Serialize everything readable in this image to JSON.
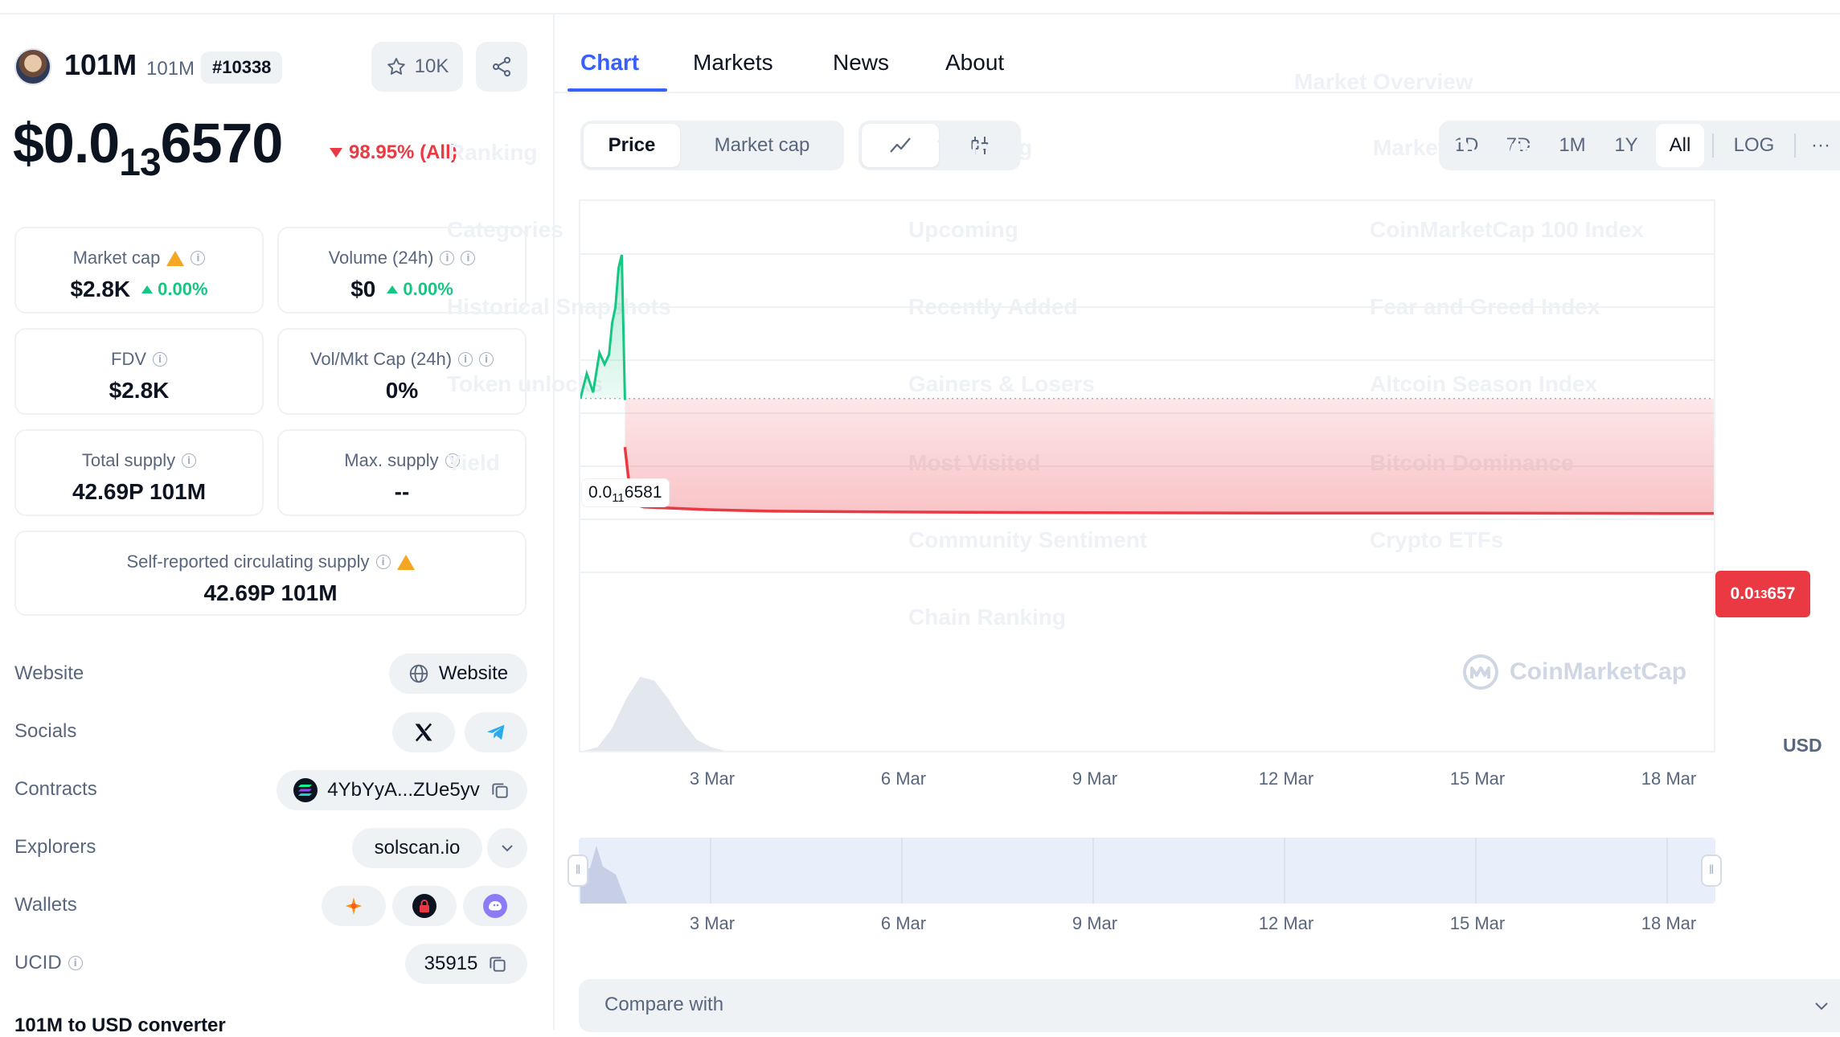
{
  "coin": {
    "name": "101M",
    "symbol": "101M",
    "rank": "#10338",
    "watchlist_count": "10K",
    "price_main": "$0.0",
    "price_sub": "13",
    "price_tail": "6570",
    "change": "98.95% (All)"
  },
  "stats": {
    "market_cap_label": "Market cap",
    "market_cap_value": "$2.8K",
    "market_cap_change": "0.00%",
    "volume_label": "Volume (24h)",
    "volume_value": "$0",
    "volume_change": "0.00%",
    "fdv_label": "FDV",
    "fdv_value": "$2.8K",
    "volmkt_label": "Vol/Mkt Cap (24h)",
    "volmkt_value": "0%",
    "total_supply_label": "Total supply",
    "total_supply_value": "42.69P 101M",
    "max_supply_label": "Max. supply",
    "max_supply_value": "--",
    "circ_label": "Self-reported circulating supply",
    "circ_value": "42.69P 101M"
  },
  "info_rows": {
    "website_label": "Website",
    "website_button": "Website",
    "socials_label": "Socials",
    "contracts_label": "Contracts",
    "contract_address": "4YbYyA...ZUe5yv",
    "explorers_label": "Explorers",
    "explorer_value": "solscan.io",
    "wallets_label": "Wallets",
    "ucid_label": "UCID",
    "ucid_value": "35915",
    "converter_title": "101M to USD converter"
  },
  "tabs": [
    "Chart",
    "Markets",
    "News",
    "About"
  ],
  "chart_controls": {
    "metric_options": [
      "Price",
      "Market cap"
    ],
    "ranges": [
      "1D",
      "7D",
      "1M",
      "1Y",
      "All"
    ],
    "log_label": "LOG",
    "more_label": "···"
  },
  "chart_labels": {
    "tooltip_left_main": "0.0",
    "tooltip_left_sub": "11",
    "tooltip_left_tail": "6581",
    "tooltip_right_main": "0.0",
    "tooltip_right_sub": "13",
    "tooltip_right_tail": "657",
    "currency": "USD",
    "watermark": "CoinMarketCap"
  },
  "ghost_menu": [
    "Trending",
    "Market Overview",
    "Ranking",
    "Categories",
    "Upcoming",
    "CoinMarketCap 100 Index",
    "Historical Snapshots",
    "Recently Added",
    "Fear and Greed Index",
    "Token unlocks",
    "Gainers & Losers",
    "Altcoin Season Index",
    "Yield",
    "Most Visited",
    "Bitcoin Dominance",
    "Community Sentiment",
    "Crypto ETFs",
    "Chain Ranking",
    "Market Overview"
  ],
  "compare_label": "Compare with",
  "colors": {
    "accent": "#3861fb",
    "up": "#16c784",
    "down": "#ea3943",
    "muted": "#58667e"
  },
  "chart_data": {
    "type": "area",
    "x_ticks": [
      "3 Mar",
      "6 Mar",
      "9 Mar",
      "12 Mar",
      "15 Mar",
      "18 Mar"
    ],
    "navigator_ticks": [
      "3 Mar",
      "6 Mar",
      "9 Mar",
      "12 Mar",
      "15 Mar",
      "18 Mar"
    ],
    "series": [
      {
        "color": "#16c784",
        "x_days": [
          0.0,
          0.1,
          0.2,
          0.3,
          0.38,
          0.45,
          0.5,
          0.55,
          0.6,
          0.65,
          0.7
        ],
        "y": [
          6.58,
          7.9,
          6.9,
          9.0,
          8.4,
          8.9,
          10.6,
          11.4,
          13.5,
          14.2,
          6.5
        ]
      },
      {
        "color": "#ea3943",
        "x_days": [
          0.7,
          0.8,
          1.0,
          2.0,
          3.0,
          5.0,
          8.0,
          11.0,
          14.0,
          17.0,
          18.0
        ],
        "y": [
          4.0,
          1.0,
          0.82,
          0.68,
          0.6,
          0.56,
          0.52,
          0.5,
          0.5,
          0.48,
          0.48
        ]
      }
    ],
    "reference_line": 6.58,
    "volume_profile": [
      0.0,
      0.05,
      0.3,
      0.7,
      1.0,
      0.95,
      0.7,
      0.4,
      0.15,
      0.05,
      0.0
    ]
  }
}
